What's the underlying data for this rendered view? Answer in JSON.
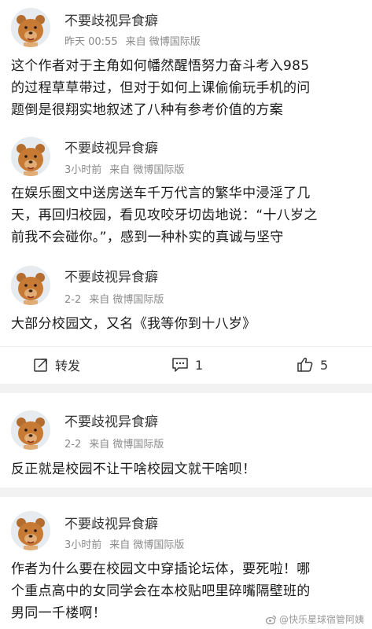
{
  "colors": {
    "background": "#f2f2f2",
    "card": "#ffffff",
    "meta": "#8a8a8a"
  },
  "comments": [
    {
      "username": "不要歧视异食癖",
      "time": "昨天 00:55",
      "source": "来自 微博国际版",
      "lines": [
        "这个作者对于主角如何幡然醒悟努力奋斗考入985",
        "的过程草草带过，但对于如何上课偷偷玩手机的问",
        "题倒是很翔实地叙述了八种有参考价值的方案"
      ]
    },
    {
      "username": "不要歧视异食癖",
      "time": "3小时前",
      "source": "来自 微博国际版",
      "lines": [
        "在娱乐圈文中送房送车千万代言的繁华中浸淫了几",
        "天，再回归校园，看见攻咬牙切齿地说：“十八岁之",
        "前我不会碰你。”，感到一种朴实的真诚与坚守"
      ]
    },
    {
      "username": "不要歧视异食癖",
      "time": "2-2",
      "source": "来自 微博国际版",
      "lines": [
        "大部分校园文，又名《我等你到十八岁》"
      ]
    },
    {
      "username": "不要歧视异食癖",
      "time": "2-2",
      "source": "来自 微博国际版",
      "lines": [
        "反正就是校园不让干啥校园文就干啥呗！"
      ]
    },
    {
      "username": "不要歧视异食癖",
      "time": "3小时前",
      "source": "来自 微博国际版",
      "lines": [
        "作者为什么要在校园文中穿插论坛体，要死啦！哪",
        "个重点高中的女同学会在本校贴吧里碎嘴隔壁班的",
        "男同一千楼啊！"
      ]
    }
  ],
  "actions": {
    "repost_label": "转发",
    "comment_count": "1",
    "like_count": "5"
  },
  "watermark": "@快乐星球宿管阿姨"
}
